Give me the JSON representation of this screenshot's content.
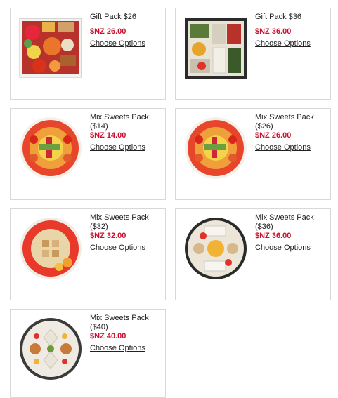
{
  "products": [
    {
      "name": "Gift Pack $26",
      "price": "$NZ 26.00",
      "link": "Choose Options"
    },
    {
      "name": "Gift Pack $36",
      "price": "$NZ 36.00",
      "link": "Choose Options"
    },
    {
      "name": "Mix Sweets Pack ($14)",
      "price": "$NZ 14.00",
      "link": "Choose Options"
    },
    {
      "name": "Mix Sweets Pack ($26)",
      "price": "$NZ 26.00",
      "link": "Choose Options"
    },
    {
      "name": "Mix Sweets Pack ($32)",
      "price": "$NZ 32.00",
      "link": "Choose Options"
    },
    {
      "name": "Mix Sweets Pack ($36)",
      "price": "$NZ 36.00",
      "link": "Choose Options"
    },
    {
      "name": "Mix Sweets Pack ($40)",
      "price": "$NZ 40.00",
      "link": "Choose Options"
    }
  ],
  "colors": {
    "price": "#c8102e",
    "border": "#d8d8d8"
  }
}
